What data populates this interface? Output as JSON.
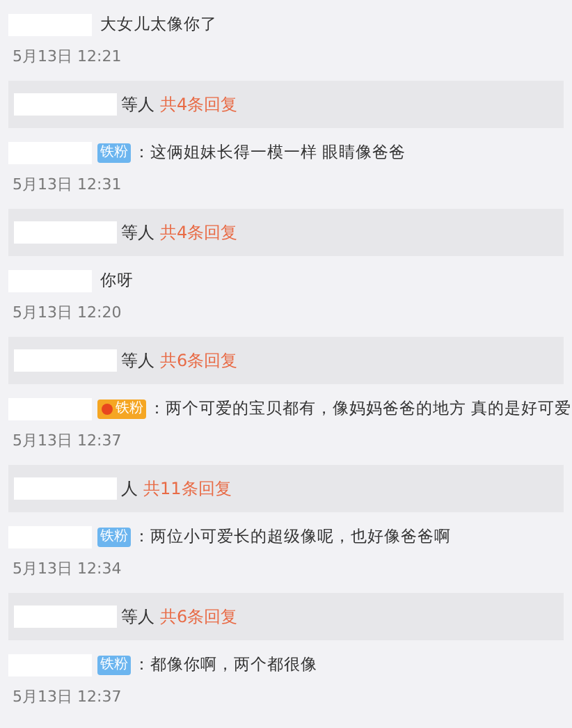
{
  "comments": [
    {
      "text": "大女儿太像你了",
      "time": "5月13日 12:21",
      "replies": {
        "who": "等人",
        "count": "共4条回复"
      }
    },
    {
      "badge": {
        "kind": "blue",
        "label": "铁粉"
      },
      "text": "：这俩姐妹长得一模一样 眼睛像爸爸",
      "time": "5月13日 12:31",
      "replies": {
        "who": "等人",
        "count": "共4条回复"
      }
    },
    {
      "text": "你呀",
      "time": "5月13日 12:20",
      "replies": {
        "who": "等人",
        "count": "共6条回复"
      }
    },
    {
      "badge": {
        "kind": "gold",
        "label": "铁粉"
      },
      "text": "：两个可爱的宝贝都有，像妈妈爸爸的地方 真的是好可爱",
      "time": "5月13日 12:37",
      "replies": {
        "who": "人",
        "count": "共11条回复"
      }
    },
    {
      "badge": {
        "kind": "blue",
        "label": "铁粉"
      },
      "text": "：两位小可爱长的超级像呢，也好像爸爸啊",
      "time": "5月13日 12:34",
      "replies": {
        "who": "等人",
        "count": "共6条回复"
      }
    },
    {
      "badge": {
        "kind": "blue",
        "label": "铁粉"
      },
      "text": "：都像你啊，两个都很像",
      "time": "5月13日 12:37"
    }
  ]
}
